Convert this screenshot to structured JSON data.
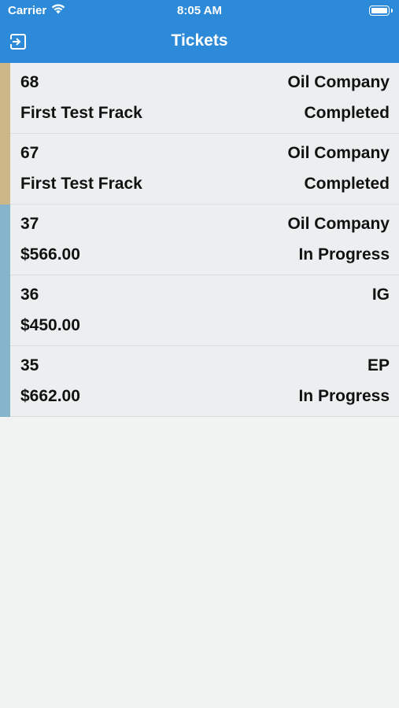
{
  "status_bar": {
    "carrier": "Carrier",
    "time": "8:05 AM",
    "wifi_icon": "wifi-icon",
    "battery_icon": "battery-icon"
  },
  "nav": {
    "title": "Tickets",
    "logout_icon": "logout-icon",
    "color": "#2c8ad8"
  },
  "colors": {
    "completed_stripe": "#cdb687",
    "in_progress_stripe": "#85b4cb"
  },
  "tickets": [
    {
      "number": "68",
      "company": "First Test Frack",
      "customer": "Oil Company",
      "status": "Completed"
    },
    {
      "number": "67",
      "company": "First Test Frack",
      "customer": "Oil Company",
      "status": "Completed"
    },
    {
      "number": "37",
      "company": "$566.00",
      "customer": "Oil Company",
      "status": "In Progress"
    },
    {
      "number": "36",
      "company": "$450.00",
      "customer": "IG",
      "status": ""
    },
    {
      "number": "35",
      "company": "$662.00",
      "customer": "EP",
      "status": "In Progress"
    }
  ]
}
